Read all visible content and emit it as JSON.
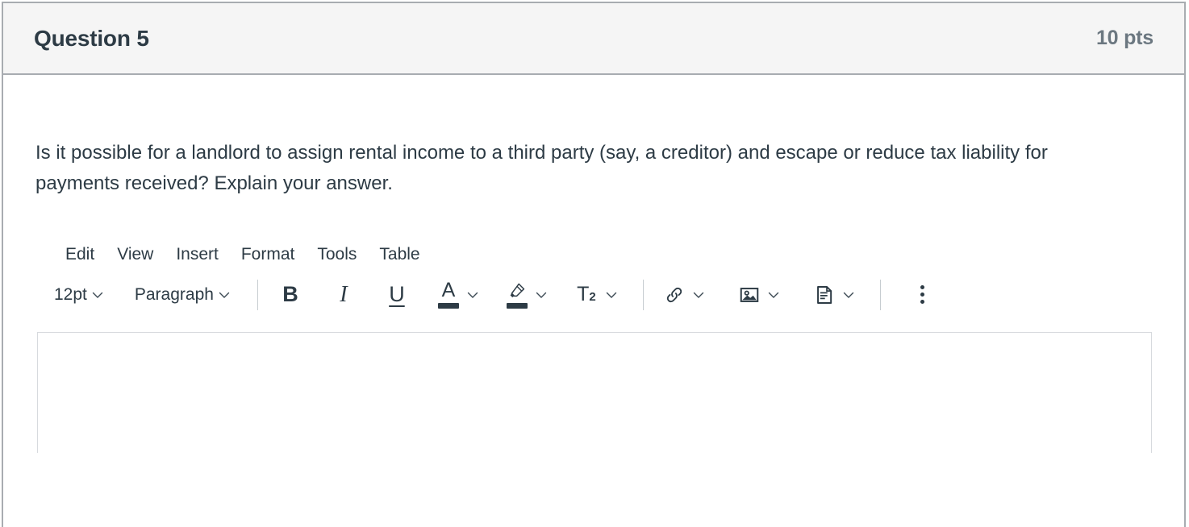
{
  "question": {
    "title": "Question 5",
    "points": "10 pts",
    "text": "Is it possible for a landlord to assign rental income to a third party (say, a creditor) and escape or reduce tax liability for payments received? Explain your answer."
  },
  "editor": {
    "menubar": [
      {
        "label": "Edit"
      },
      {
        "label": "View"
      },
      {
        "label": "Insert"
      },
      {
        "label": "Format"
      },
      {
        "label": "Tools"
      },
      {
        "label": "Table"
      }
    ],
    "toolbar": {
      "font_size": "12pt",
      "block_format": "Paragraph",
      "bold_label": "B",
      "italic_label": "I",
      "underline_label": "U",
      "text_color_label": "A",
      "superscript_label": "T",
      "superscript_exponent": "2",
      "icons": {
        "font_size_chevron": "chevron-down-icon",
        "block_format_chevron": "chevron-down-icon",
        "bold": "bold-icon",
        "italic": "italic-icon",
        "underline": "underline-icon",
        "text_color": "text-color-icon",
        "highlight": "highlighter-icon",
        "superscript": "superscript-icon",
        "link": "link-icon",
        "image": "image-icon",
        "document": "document-icon",
        "more": "kebab-more-icon"
      }
    },
    "content": ""
  },
  "colors": {
    "header_bg": "#f5f5f5",
    "border": "#a8acb1",
    "title_text": "#2d3b45",
    "points_text": "#6b7780",
    "icon": "#2d3b45",
    "text_color_swatch": "#2d3b45",
    "highlight_swatch": "#2d3b45",
    "editor_border": "#d7dade",
    "divider": "#c7cdd1"
  }
}
